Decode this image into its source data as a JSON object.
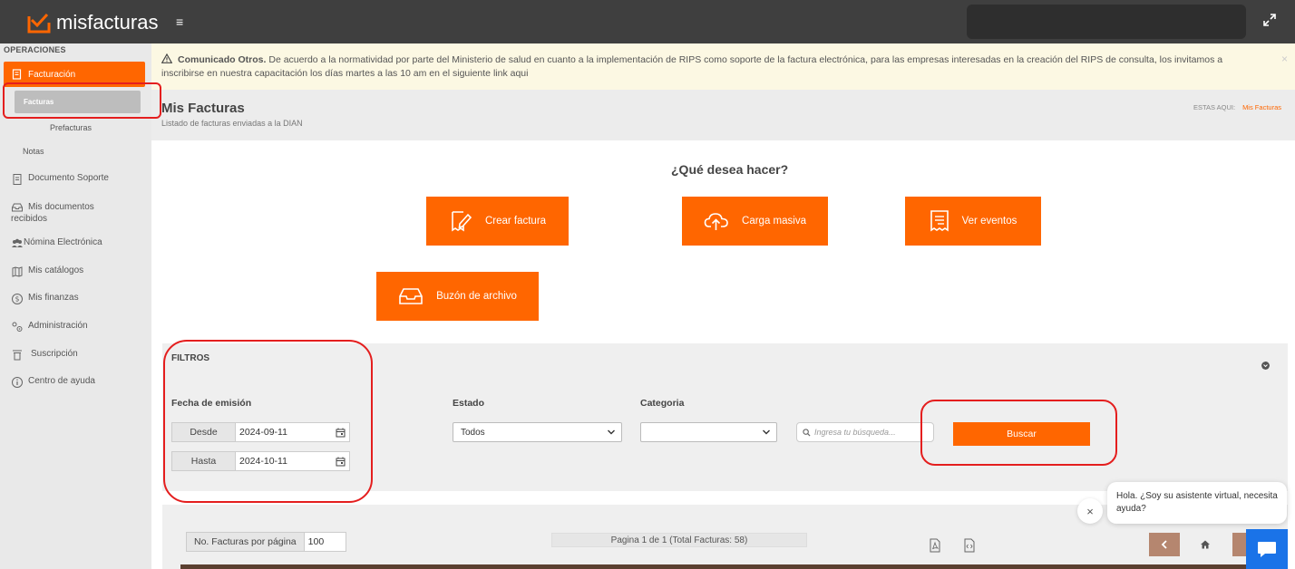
{
  "app": {
    "brand": "misfacturas",
    "hamburger_glyph": "≡"
  },
  "colors": {
    "accent": "#ff6600",
    "topbar": "#3f3f3f",
    "sidebar": "#e9e9e9",
    "notice_bg": "#fcf8e3",
    "annotation": "#e41e1e",
    "chat_blue": "#1a73e8"
  },
  "sidebar": {
    "heading": "OPERACIONES",
    "active_item": {
      "label": "Facturación",
      "icon": "invoice-icon"
    },
    "sub_active": "Facturas",
    "sub_items": [
      "Prefacturas",
      "Notas"
    ],
    "items": [
      {
        "label": "Documento Soporte",
        "icon": "document-icon"
      },
      {
        "label_line1": "Mis documentos",
        "label_line2": "recibidos",
        "icon": "inbox-icon"
      },
      {
        "label": "Nómina Electrónica",
        "icon": "users-icon"
      },
      {
        "label": "Mis catálogos",
        "icon": "map-icon"
      },
      {
        "label": "Mis finanzas",
        "icon": "dollar-icon"
      },
      {
        "label": "Administración",
        "icon": "admin-icon"
      },
      {
        "label": "Suscripción",
        "icon": "subscription-icon"
      },
      {
        "label": "Centro de ayuda",
        "icon": "info-icon"
      }
    ]
  },
  "notice": {
    "title": "Comunicado Otros.",
    "text": "De acuerdo a la normatividad por parte del Ministerio de salud en cuanto a la implementación de RIPS como soporte de la factura electrónica, para las empresas interesadas en la creación del RIPS de consulta, los invitamos a inscribirse en nuestra capacitación los días martes a las 10 am en el siguiente link aqui",
    "close": "×"
  },
  "page": {
    "title": "Mis Facturas",
    "subtitle": "Listado de facturas enviadas a la DIAN",
    "breadcrumb_label": "ESTAS AQUI:",
    "breadcrumb_link": "Mis Facturas"
  },
  "actions": {
    "question": "¿Qué desea hacer?",
    "buttons": [
      {
        "label": "Crear factura",
        "icon": "edit-document-icon"
      },
      {
        "label": "Carga masiva",
        "icon": "cloud-upload-icon"
      },
      {
        "label": "Ver eventos",
        "icon": "receipt-icon"
      },
      {
        "label": "Buzón de archivo",
        "icon": "inbox-tray-icon"
      }
    ]
  },
  "filters": {
    "title": "FILTROS",
    "fecha_label": "Fecha de emisión",
    "desde_label": "Desde",
    "desde_value": "2024-09-11",
    "hasta_label": "Hasta",
    "hasta_value": "2024-10-11",
    "estado_label": "Estado",
    "estado_value": "Todos",
    "categoria_label": "Categoria",
    "categoria_value": "",
    "search_placeholder": "Ingresa tu búsqueda...",
    "search_button": "Buscar"
  },
  "results": {
    "per_page_label": "No. Facturas por página",
    "per_page_value": "100",
    "paging_text": "Pagina 1 de 1 (Total Facturas: 58)"
  },
  "chat": {
    "message": "Hola. ¿Soy su asistente virtual, necesita ayuda?",
    "close": "×"
  }
}
